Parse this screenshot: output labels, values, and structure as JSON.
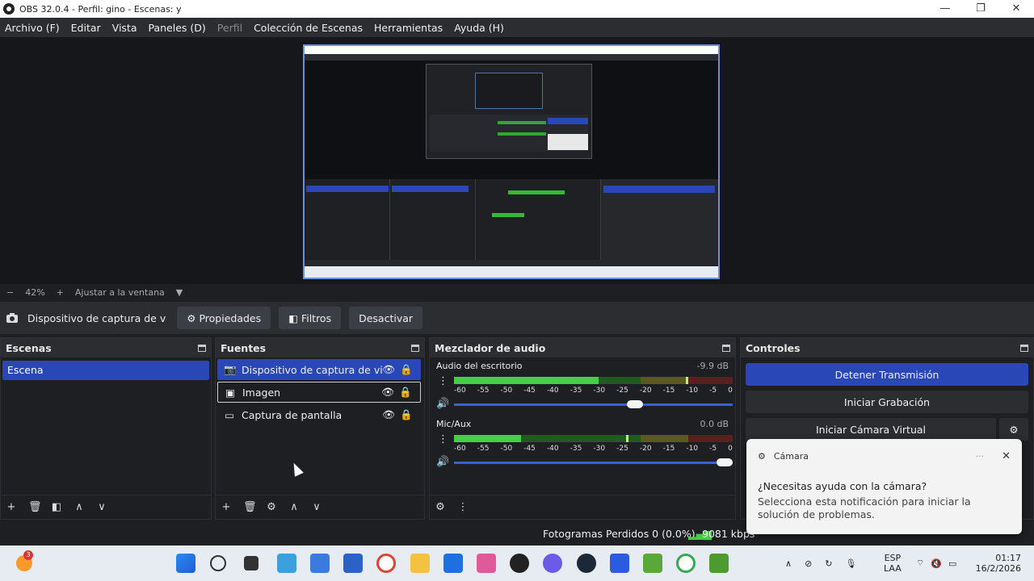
{
  "window": {
    "title": "OBS 32.0.4 - Perfil: gino - Escenas: y",
    "controls": [
      "—",
      "❐",
      "✕"
    ]
  },
  "menu": {
    "items": [
      "Archivo (F)",
      "Editar",
      "Vista",
      "Paneles (D)",
      "Perfil",
      "Colección de Escenas",
      "Herramientas",
      "Ayuda (H)"
    ]
  },
  "zoom": {
    "minus": "−",
    "value": "42%",
    "plus": "+",
    "fit": "Ajustar a la ventana",
    "caret": "▼"
  },
  "source_toolbar": {
    "source_name": "Dispositivo de captura de v",
    "properties": "Propiedades",
    "filters": "Filtros",
    "deactivate": "Desactivar"
  },
  "scenes": {
    "title": "Escenas",
    "items": [
      "Escena"
    ]
  },
  "sources": {
    "title": "Fuentes",
    "items": [
      "Dispositivo de captura de video",
      "Imagen",
      "Captura de pantalla"
    ]
  },
  "mixer": {
    "title": "Mezclador de audio",
    "ticks": [
      "-60",
      "-55",
      "-50",
      "-45",
      "-40",
      "-35",
      "-30",
      "-25",
      "-20",
      "-15",
      "-10",
      "-5",
      "0"
    ],
    "channels": [
      {
        "name": "Audio del escritorio",
        "db": "-9.9 dB",
        "level": 0.52,
        "volume": 0.65
      },
      {
        "name": "Mic/Aux",
        "db": "0.0 dB",
        "level": 0.24,
        "volume": 0.97
      }
    ]
  },
  "controls": {
    "title": "Controles",
    "stop_stream": "Detener Transmisión",
    "start_record": "Iniciar Grabación",
    "start_vcam": "Iniciar Cámara Virtual"
  },
  "notification": {
    "app": "Cámara",
    "title": "¿Necesitas ayuda con la cámara?",
    "body": "Selecciona esta notificación para iniciar la solución de problemas."
  },
  "status": {
    "dropped": "Fotogramas Perdidos 0 (0.0%)",
    "bitrate": "9081 kbps"
  },
  "taskbar": {
    "badge": "3",
    "lang1": "ESP",
    "lang2": "LAA",
    "time": "01:17",
    "date": "16/2/2026"
  }
}
